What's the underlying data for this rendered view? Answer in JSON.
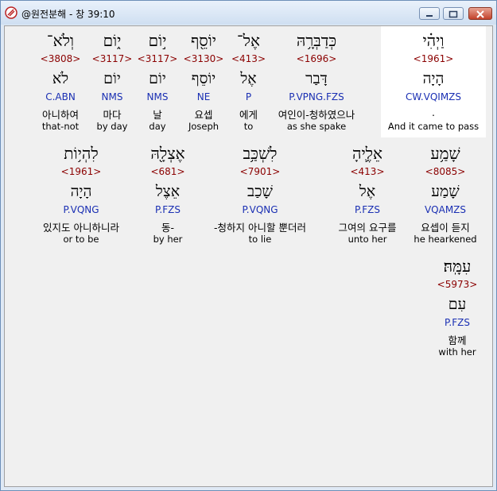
{
  "window": {
    "title": "@원전분해 - 창 39:10"
  },
  "words": [
    {
      "hebrew": "וַיְהִ֗י",
      "strong": "<1961>",
      "lemma": "הָיָה",
      "morph": "CW.VQIMZS",
      "korean": ".",
      "english": "And it came to pass",
      "highlighted": true
    },
    {
      "hebrew": "כְּדַבְּרָ֥הּ",
      "strong": "<1696>",
      "lemma": "דָּבַר",
      "morph": "P.VPNG.FZS",
      "korean": "여인이-청하였으나",
      "english": "as she spake",
      "highlighted": false
    },
    {
      "hebrew": "אֶל־",
      "strong": "<413>",
      "lemma": "אֶל",
      "morph": "P",
      "korean": "에게",
      "english": "to",
      "highlighted": false
    },
    {
      "hebrew": "יוֹסֵ֖ף",
      "strong": "<3130>",
      "lemma": "יוֹסֵף",
      "morph": "NE",
      "korean": "요셉",
      "english": "Joseph",
      "highlighted": false
    },
    {
      "hebrew": "י֣וֹם",
      "strong": "<3117>",
      "lemma": "יוֹם",
      "morph": "NMS",
      "korean": "날",
      "english": "day",
      "highlighted": false
    },
    {
      "hebrew": "י֑וֹם",
      "strong": "<3117>",
      "lemma": "יוֹם",
      "morph": "NMS",
      "korean": "마다",
      "english": "by day",
      "highlighted": false
    },
    {
      "hebrew": "וְלֹא־",
      "strong": "<3808>",
      "lemma": "לֹא",
      "morph": "C.ABN",
      "korean": "아니하여",
      "english": "that-not",
      "highlighted": false
    },
    {
      "hebrew": "שָׁמַ֥ע",
      "strong": "<8085>",
      "lemma": "שָׁמַע",
      "morph": "VQAMZS",
      "korean": "요셉이 듣지",
      "english": "he hearkened",
      "highlighted": false
    },
    {
      "hebrew": "אֵלֶ֛יהָ",
      "strong": "<413>",
      "lemma": "אֶל",
      "morph": "P.FZS",
      "korean": "그여의 요구를",
      "english": "unto her",
      "highlighted": false
    },
    {
      "hebrew": "לִשְׁכַּ֥ב",
      "strong": "<7901>",
      "lemma": "שָׁכַב",
      "morph": "P.VQNG",
      "korean": "-청하지 아니할 뿐더러",
      "english": "to lie",
      "highlighted": false
    },
    {
      "hebrew": "אֶצְלָ֖הּ",
      "strong": "<681>",
      "lemma": "אֵצֶל",
      "morph": "P.FZS",
      "korean": "동-",
      "english": "by her",
      "highlighted": false
    },
    {
      "hebrew": "לִהְי֥וֹת",
      "strong": "<1961>",
      "lemma": "הָיָה",
      "morph": "P.VQNG",
      "korean": "있지도 아니하니라",
      "english": "or to be",
      "highlighted": false
    },
    {
      "hebrew": "עִמָּֽהּ׃",
      "strong": "<5973>",
      "lemma": "עִם",
      "morph": "P.FZS",
      "korean": "함께",
      "english": "with her",
      "highlighted": false
    }
  ]
}
